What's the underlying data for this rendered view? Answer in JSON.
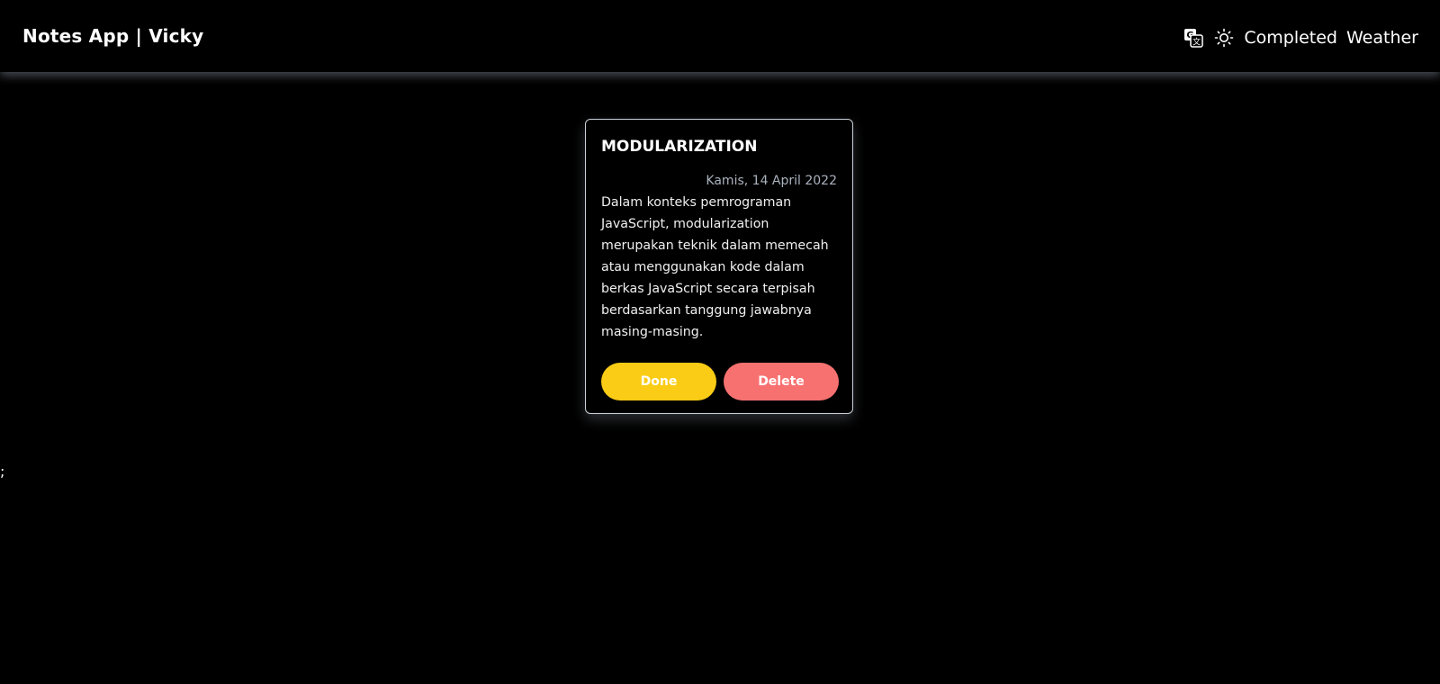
{
  "navbar": {
    "brand": "Notes App | Vicky",
    "translate_icon": "translate-icon",
    "theme_icon": "sun-icon",
    "links": [
      {
        "label": "Completed"
      },
      {
        "label": "Weather"
      }
    ]
  },
  "note": {
    "title": "MODULARIZATION",
    "date": "Kamis, 14 April 2022",
    "body": "Dalam konteks pemrograman JavaScript, modularization merupakan teknik dalam memecah atau menggunakan kode dalam berkas JavaScript secara terpisah berdasarkan tanggung jawabnya masing-masing.",
    "done_label": "Done",
    "delete_label": "Delete"
  },
  "stray_text": ";",
  "colors": {
    "background": "#000000",
    "done": "#facc15",
    "delete": "#f87171",
    "date": "#aab2be"
  }
}
